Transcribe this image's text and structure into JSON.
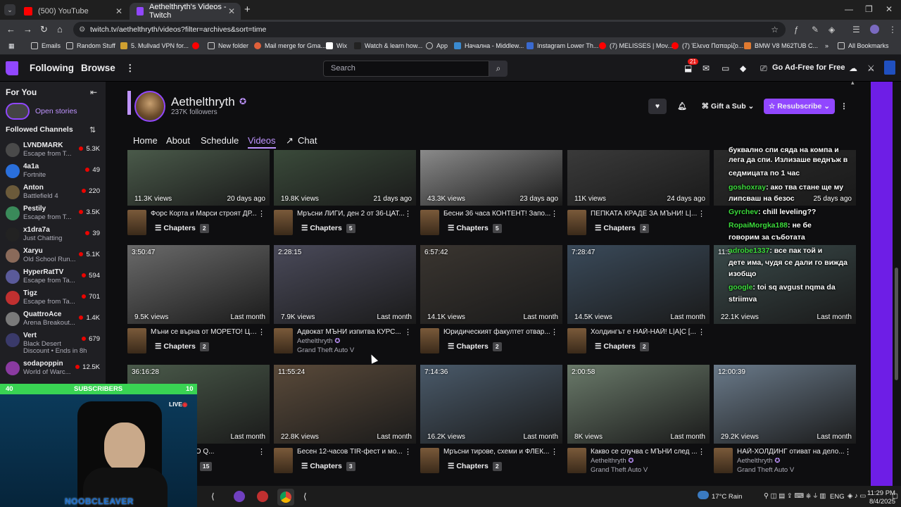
{
  "browser": {
    "tabs": [
      {
        "title": "(500) YouTube",
        "active": false
      },
      {
        "title": "Aethelthryth's Videos - Twitch",
        "active": true
      }
    ],
    "url": "twitch.tv/aethelthryth/videos?filter=archives&sort=time",
    "bookmarks": [
      "Emails",
      "Random Stuff",
      "5. Mullvad VPN for...",
      "New folder",
      "Mail merge for Gma...",
      "Wix",
      "Watch & learn how...",
      "App",
      "Начална - Middlew...",
      "Instagram Lower Th...",
      "(7) MELISSES | Mov...",
      "(7) Έλενα Παπαρίζο...",
      "BMW V8 M62TUB C...",
      "All Bookmarks"
    ]
  },
  "topnav": {
    "following": "Following",
    "browse": "Browse",
    "search_placeholder": "Search",
    "notif_count": "21",
    "ad_free": "Go Ad-Free for Free"
  },
  "sidebar": {
    "for_you": "For You",
    "open_stories": "Open stories",
    "followed_channels": "Followed Channels",
    "channels": [
      {
        "name": "LVNDMARK",
        "game": "Escape from T...",
        "viewers": "5.3K",
        "color": "#4a4a4a"
      },
      {
        "name": "4a1a",
        "game": "Fortnite",
        "viewers": "49",
        "color": "#2a6fdb"
      },
      {
        "name": "Anton",
        "game": "Battlefield 4",
        "viewers": "220",
        "color": "#6b5a3a"
      },
      {
        "name": "Pestily",
        "game": "Escape from T...",
        "viewers": "3.5K",
        "color": "#3a8a5a"
      },
      {
        "name": "x1dra7a",
        "game": "Just Chatting",
        "viewers": "39",
        "color": "#222"
      },
      {
        "name": "Xaryu",
        "game": "Old School Run...",
        "viewers": "5.1K",
        "color": "#8a6a5a"
      },
      {
        "name": "HyperRatTV",
        "game": "Escape from Ta...",
        "viewers": "594",
        "color": "#5a5a9a"
      },
      {
        "name": "Tigz",
        "game": "Escape from Ta...",
        "viewers": "701",
        "color": "#c03030"
      },
      {
        "name": "QuattroAce",
        "game": "Arena Breakout...",
        "viewers": "1.4K",
        "color": "#7a7a7a"
      },
      {
        "name": "Vert",
        "game": "Black Desert",
        "viewers": "679",
        "color": "#3a3a6a",
        "extra": "Discount • Ends in 8h"
      },
      {
        "name": "sodapoppin",
        "game": "World of Warc...",
        "viewers": "12.5K",
        "color": "#8a3aa0"
      }
    ]
  },
  "channel": {
    "name": "Aethelthryth",
    "followers": "237K followers",
    "gift_sub": "Gift a Sub",
    "resubscribe": "Resubscribe",
    "tabs": [
      "Home",
      "About",
      "Schedule",
      "Videos",
      "Chat"
    ],
    "active_tab": "Videos"
  },
  "videos": [
    {
      "dur": "",
      "views": "11.3K views",
      "date": "20 days ago",
      "title": "Форс Корта и Марси строят ДР...",
      "chapters": "2",
      "author": "",
      "category": "",
      "bg": "#4a5a4a"
    },
    {
      "dur": "",
      "views": "19.8K views",
      "date": "21 days ago",
      "title": "Мръсни ЛИГИ, ден 2 от 36-ЦАТ...",
      "chapters": "5",
      "author": "",
      "category": "",
      "bg": "#3a4a3a"
    },
    {
      "dur": "",
      "views": "43.3K views",
      "date": "23 days ago",
      "title": "Бесни 36 часа КОНТЕНТ! Запо...",
      "chapters": "5",
      "author": "",
      "category": "",
      "bg": "#8a8a8a"
    },
    {
      "dur": "",
      "views": "11K views",
      "date": "24 days ago",
      "title": "ПЕПКАТА КРАДЕ ЗА МЪНИ! L|...",
      "chapters": "2",
      "author": "",
      "category": "",
      "bg": "#3a3a3a"
    },
    {
      "dur": "",
      "views": "",
      "date": "25 days ago",
      "title": "",
      "chapters": "",
      "author": "",
      "category": "",
      "bg": "#2a2a2a"
    },
    {
      "dur": "3:50:47",
      "views": "9.5K views",
      "date": "Last month",
      "title": "Мъни се върна от МОРЕТО! Цъ...",
      "chapters": "2",
      "author": "",
      "category": "",
      "bg": "#6a6a6a"
    },
    {
      "dur": "2:28:15",
      "views": "7.9K views",
      "date": "Last month",
      "title": "Адвокат МЪНИ изпитва КУРС...",
      "chapters": "",
      "author": "Aethelthryth",
      "category": "Grand Theft Auto V",
      "bg": "#4a4a5a"
    },
    {
      "dur": "6:57:42",
      "views": "14.1K views",
      "date": "Last month",
      "title": "Юридическият факултет отвар...",
      "chapters": "2",
      "author": "",
      "category": "",
      "bg": "#3a3530"
    },
    {
      "dur": "7:28:47",
      "views": "14.5K views",
      "date": "Last month",
      "title": "Холдингът е НАЙ-НАЙ! L|A|C [...",
      "chapters": "2",
      "author": "",
      "category": "",
      "bg": "#3a4a5a"
    },
    {
      "dur": "11:5",
      "views": "22.1K views",
      "date": "Last month",
      "title": "12 часа тегав холдингов РП! L|...",
      "chapters": "2",
      "author": "",
      "category": "",
      "bg": "#3a4a4a"
    },
    {
      "dur": "36:16:28",
      "views": "",
      "date": "Last month",
      "title": "а! Малко YOLO Q...",
      "chapters": "15",
      "author": "",
      "category": "",
      "bg": "#4a5a4a"
    },
    {
      "dur": "11:55:24",
      "views": "22.8K views",
      "date": "Last month",
      "title": "Бесен 12-часов TIR-фест и мо...",
      "chapters": "3",
      "author": "",
      "category": "",
      "bg": "#5a4a3a"
    },
    {
      "dur": "7:14:36",
      "views": "16.2K views",
      "date": "Last month",
      "title": "Мръсни тирове, схеми и ФЛЕК...",
      "chapters": "2",
      "author": "",
      "category": "",
      "bg": "#4a5a6a"
    },
    {
      "dur": "2:00:58",
      "views": "8K views",
      "date": "Last month",
      "title": "Какво се случва с МЪНИ след ...",
      "chapters": "",
      "author": "Aethelthryth",
      "category": "Grand Theft Auto V",
      "bg": "#6a7a6a"
    },
    {
      "dur": "12:00:39",
      "views": "29.2K views",
      "date": "Last month",
      "title": "НАЙ-ХОЛДИНГ отиват на дело...",
      "chapters": "",
      "author": "Aethelthryth",
      "category": "Grand Theft Auto V",
      "bg": "#6a7a8a"
    }
  ],
  "chapters_label": "Chapters",
  "chat_overlay": [
    {
      "user": "",
      "text": "буквално спи сяда на компа и"
    },
    {
      "user": "",
      "text": "лега да спи. Излизаше веднъж в"
    },
    {
      "user": "",
      "text": "седмицата по 1 час"
    },
    {
      "user": "goshoxray",
      "text": ": ако тва стане ще му"
    },
    {
      "user": "",
      "text": "липсваш на безос"
    },
    {
      "user": "Gyrchev",
      "text": ": chill leveling??"
    },
    {
      "user": "RopaiMorgka188",
      "text": ": не бе"
    },
    {
      "user": "",
      "text": "говорим за съботата"
    },
    {
      "user": "adrobe1337",
      "text": ": все пак той и"
    },
    {
      "user": "",
      "text": "дете има, чудя се дали го вижда"
    },
    {
      "user": "",
      "text": "изобщо"
    },
    {
      "user": "google",
      "text": ": toi sq avgust nqma da"
    },
    {
      "user": "",
      "text": "striimva"
    }
  ],
  "overlay": {
    "sub_left": "40",
    "sub_label": "SUBSCRIBERS",
    "sub_right": "10",
    "live": "LIVE",
    "streamer_tag": "NOOBCLEAVER"
  },
  "taskbar": {
    "weather": "17°C Rain",
    "lang": "ENG",
    "time": "11:29 PM",
    "date": "8/4/2025"
  }
}
